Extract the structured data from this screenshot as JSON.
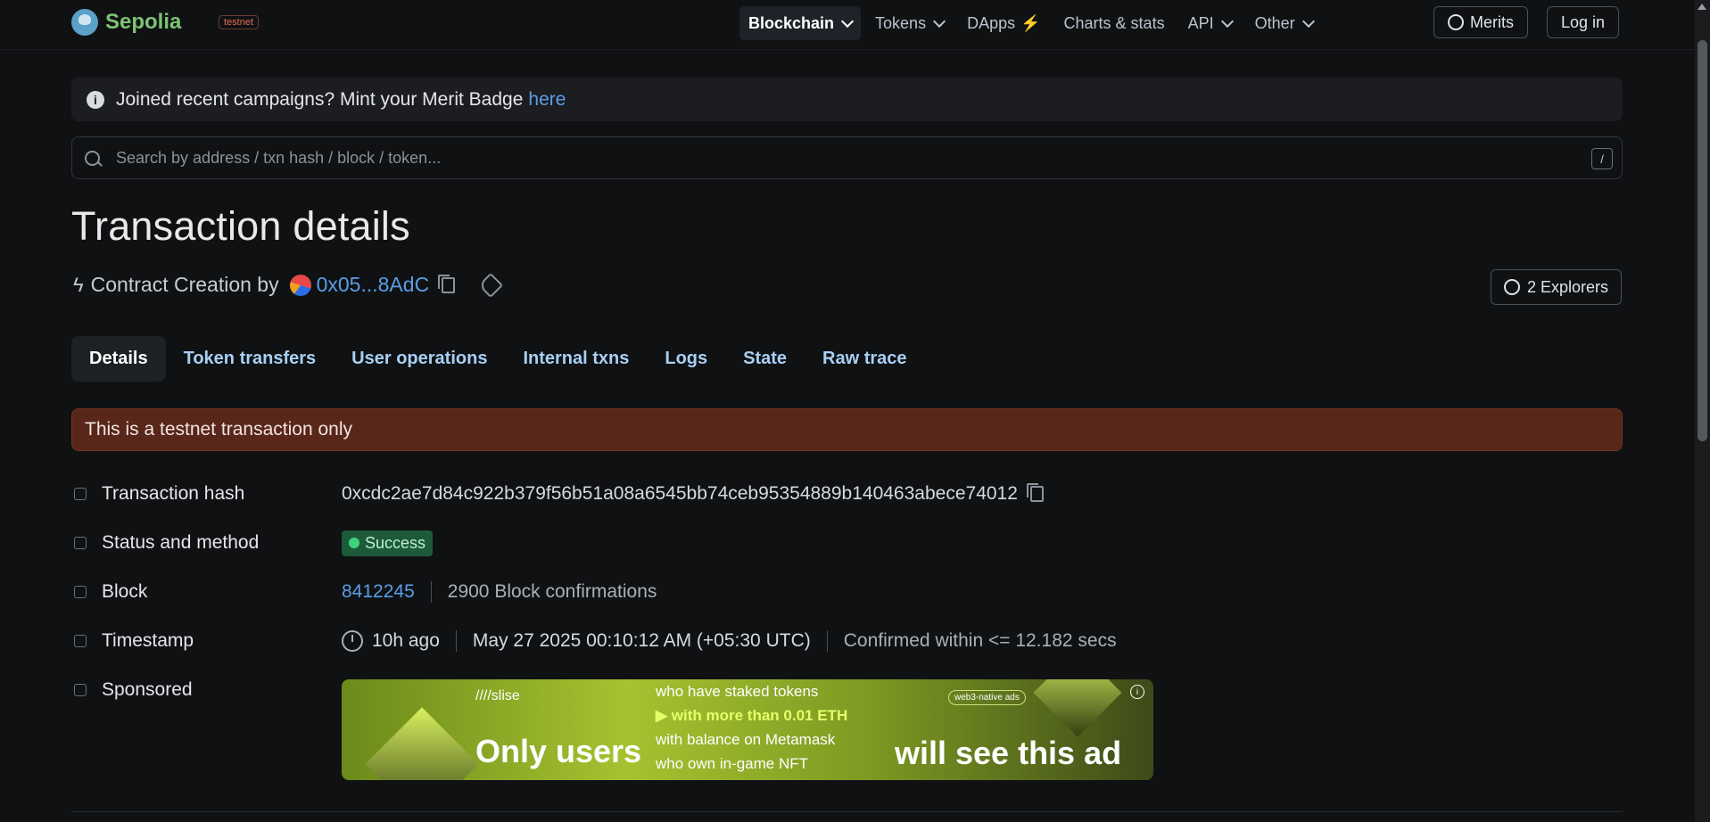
{
  "header": {
    "logo_text": "Sepolia",
    "network_badge": "testnet",
    "nav": [
      {
        "label": "Blockchain",
        "active": true,
        "has_chevron": true
      },
      {
        "label": "Tokens",
        "active": false,
        "has_chevron": true
      },
      {
        "label": "DApps",
        "active": false,
        "has_chevron": false
      },
      {
        "label": "Charts & stats",
        "active": false,
        "has_chevron": false
      },
      {
        "label": "API",
        "active": false,
        "has_chevron": true
      },
      {
        "label": "Other",
        "active": false,
        "has_chevron": true
      }
    ],
    "merits_label": "Merits",
    "login_label": "Log in"
  },
  "banner": {
    "text": "Joined recent campaigns? Mint your Merit Badge",
    "link_text": "here"
  },
  "search": {
    "placeholder": "Search by address / txn hash / block / token...",
    "shortcut": "/"
  },
  "page": {
    "title": "Transaction details",
    "subtitle_prefix": "Contract Creation by",
    "creator_address": "0x05...8AdC",
    "explorers_label": "2 Explorers"
  },
  "tabs": [
    {
      "label": "Details",
      "active": true
    },
    {
      "label": "Token transfers",
      "active": false
    },
    {
      "label": "User operations",
      "active": false
    },
    {
      "label": "Internal txns",
      "active": false
    },
    {
      "label": "Logs",
      "active": false
    },
    {
      "label": "State",
      "active": false
    },
    {
      "label": "Raw trace",
      "active": false
    }
  ],
  "warning": "This is a testnet transaction only",
  "details": {
    "tx_hash_label": "Transaction hash",
    "tx_hash": "0xcdc2ae7d84c922b379f56b51a08a6545bb74ceb95354889b140463abece74012",
    "status_label": "Status and method",
    "status": "Success",
    "block_label": "Block",
    "block": "8412245",
    "confirmations": "2900 Block confirmations",
    "timestamp_label": "Timestamp",
    "time_ago": "10h ago",
    "datetime": "May 27 2025 00:10:12 AM (+05:30 UTC)",
    "confirmed_within": "Confirmed within <= 12.182 secs",
    "sponsored_label": "Sponsored"
  },
  "ad": {
    "brand": "////slise",
    "big_left": "Only users",
    "lines": [
      "who have staked tokens",
      "with more than 0.01 ETH",
      "with balance on Metamask",
      "who own in-game NFT"
    ],
    "big_right": "will see this ad",
    "pill": "web3-native ads"
  }
}
